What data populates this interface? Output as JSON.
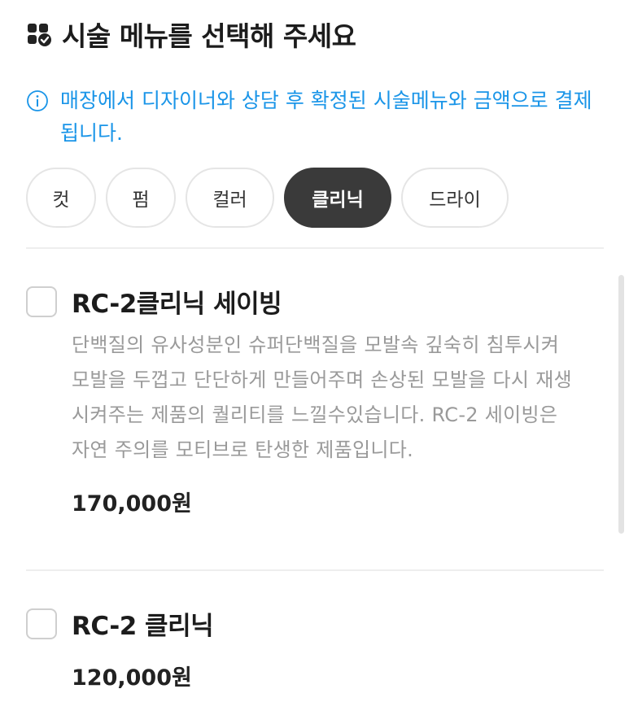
{
  "header": {
    "title": "시술 메뉴를 선택해 주세요",
    "icon": "grid-check-icon"
  },
  "notice": {
    "icon": "info-circle-icon",
    "text": "매장에서 디자이너와 상담 후 확정된 시술메뉴와 금액으로 결제됩니다.",
    "color": "#1a95e8"
  },
  "categories": [
    {
      "label": "컷",
      "active": false
    },
    {
      "label": "펌",
      "active": false
    },
    {
      "label": "컬러",
      "active": false
    },
    {
      "label": "클리닉",
      "active": true
    },
    {
      "label": "드라이",
      "active": false
    }
  ],
  "menu_items": [
    {
      "name": "RC-2클리닉 세이빙",
      "description": "단백질의 유사성분인 슈퍼단백질을 모발속 깊숙히 침투시켜 모발을 두껍고 단단하게 만들어주며 손상된 모발을 다시 재생시켜주는 제품의 퀄리티를 느낄수있습니다. RC-2 세이빙은 자연 주의를 모티브로 탄생한 제품입니다.",
      "price": "170,000원",
      "checked": false
    },
    {
      "name": "RC-2 클리닉",
      "description": "",
      "price": "120,000원",
      "checked": false
    }
  ]
}
